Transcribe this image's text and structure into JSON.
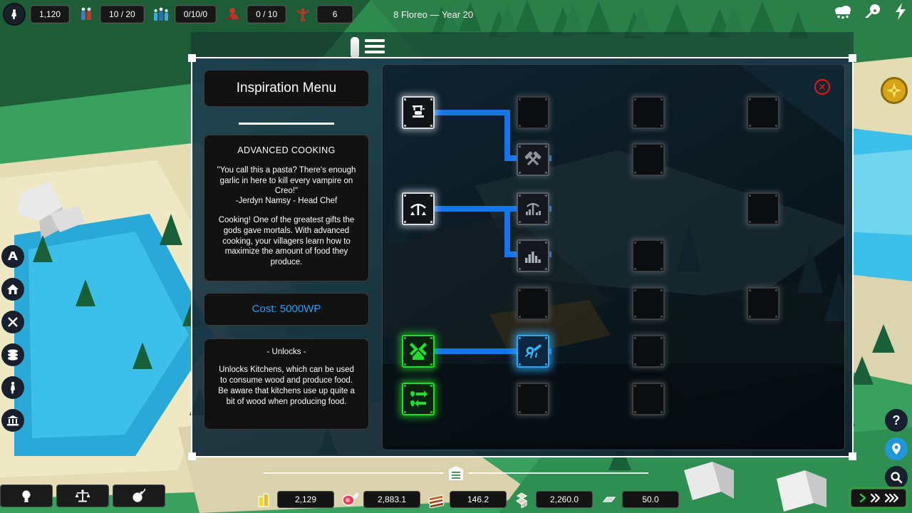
{
  "topbar": {
    "faith_icon": "prayer-icon",
    "faith_value": "1,120",
    "population_icon": "villagers-icon",
    "population_value": "10 / 20",
    "workers_icon": "workforce-icon",
    "workers_value": "0/10/0",
    "soldiers_icon": "soldier-icon",
    "soldiers_value": "0 / 10",
    "happiness_icon": "happiness-icon",
    "happiness_value": "6",
    "date_label": "8 Floreo — Year 20",
    "right_icons": [
      "weather-rain-icon",
      "comet-icon",
      "lightning-icon"
    ]
  },
  "menu_button": {
    "icon": "hamburger-menu-icon"
  },
  "left_sidebar": {
    "items": [
      {
        "icon": "military-icon",
        "label": "Military"
      },
      {
        "icon": "housing-icon",
        "label": "Housing"
      },
      {
        "icon": "tools-icon",
        "label": "Production"
      },
      {
        "icon": "resources-icon",
        "label": "Resources"
      },
      {
        "icon": "faith-icon",
        "label": "Faith"
      },
      {
        "icon": "government-icon",
        "label": "Government"
      }
    ]
  },
  "right_sidebar": {
    "compass_icon": "compass-icon",
    "items": [
      {
        "icon": "help-icon",
        "label": "Help"
      },
      {
        "icon": "location-pin-icon",
        "label": "Locate"
      },
      {
        "icon": "search-icon",
        "label": "Search"
      }
    ]
  },
  "window": {
    "title": "Inspiration Menu",
    "close_icon": "close-icon",
    "detail": {
      "name": "ADVANCED COOKING",
      "quote": "\"You call this a pasta? There's enough garlic in here to kill every vampire on Creo!\"",
      "author": "-Jerdyn Namsy - Head Chef",
      "body": "Cooking! One of the greatest gifts the gods gave mortals. With advanced cooking, your villagers learn how to maximize the amount of food they produce.",
      "cost": "Cost: 5000WP",
      "cost_color": "#2a9df4",
      "unlocks_title": "- Unlocks -",
      "unlocks_body": "Unlocks Kitchens, which can be used to consume wood and produce food. Be aware that kitchens use up quite a bit of wood when producing food."
    },
    "tech_tree": {
      "nodes": [
        {
          "id": "n-c1-r1",
          "col": 1,
          "row": 1,
          "state": "done",
          "icon": "anvil-icon"
        },
        {
          "id": "n-c2-r1",
          "col": 2,
          "row": 1,
          "state": "locked",
          "icon": "empty-icon"
        },
        {
          "id": "n-c3-r1",
          "col": 3,
          "row": 1,
          "state": "locked",
          "icon": "empty-icon"
        },
        {
          "id": "n-c4-r1",
          "col": 4,
          "row": 1,
          "state": "locked",
          "icon": "empty-icon"
        },
        {
          "id": "n-c2-r2",
          "col": 2,
          "row": 2,
          "state": "dim",
          "icon": "crossed-hammers-icon"
        },
        {
          "id": "n-c3-r2",
          "col": 3,
          "row": 2,
          "state": "locked",
          "icon": "empty-icon"
        },
        {
          "id": "n-c1-r3",
          "col": 1,
          "row": 3,
          "state": "done",
          "icon": "mine-icon"
        },
        {
          "id": "n-c2-r3",
          "col": 2,
          "row": 3,
          "state": "dim",
          "icon": "pickaxe-ore-icon"
        },
        {
          "id": "n-c4-r3",
          "col": 4,
          "row": 3,
          "state": "locked",
          "icon": "empty-icon"
        },
        {
          "id": "n-c2-r4",
          "col": 2,
          "row": 4,
          "state": "dim",
          "icon": "quarry-icon"
        },
        {
          "id": "n-c3-r4",
          "col": 3,
          "row": 4,
          "state": "locked",
          "icon": "empty-icon"
        },
        {
          "id": "n-c2-r5",
          "col": 2,
          "row": 5,
          "state": "locked",
          "icon": "empty-icon"
        },
        {
          "id": "n-c3-r5",
          "col": 3,
          "row": 5,
          "state": "locked",
          "icon": "empty-icon"
        },
        {
          "id": "n-c4-r5",
          "col": 4,
          "row": 5,
          "state": "locked",
          "icon": "empty-icon"
        },
        {
          "id": "n-c1-r6",
          "col": 1,
          "row": 6,
          "state": "green",
          "icon": "windmill-icon"
        },
        {
          "id": "n-c2-r6",
          "col": 2,
          "row": 6,
          "state": "sel",
          "icon": "cooking-pot-icon"
        },
        {
          "id": "n-c3-r6",
          "col": 3,
          "row": 6,
          "state": "locked",
          "icon": "empty-icon"
        },
        {
          "id": "n-c1-r7",
          "col": 1,
          "row": 7,
          "state": "green",
          "icon": "trade-icon"
        },
        {
          "id": "n-c2-r7",
          "col": 2,
          "row": 7,
          "state": "locked",
          "icon": "empty-icon"
        },
        {
          "id": "n-c3-r7",
          "col": 3,
          "row": 7,
          "state": "locked",
          "icon": "empty-icon"
        }
      ],
      "link_color": "#1675e8",
      "colors": {
        "researched": "#d8dde1",
        "available": "#22dd2a",
        "selected": "#2ea8f0",
        "locked": "#3b3f42"
      }
    }
  },
  "bottom_bar": {
    "buttons": [
      {
        "icon": "lightbulb-icon",
        "label": "Inspiration"
      },
      {
        "icon": "scales-icon",
        "label": "Laws"
      },
      {
        "icon": "bomb-icon",
        "label": "Disasters"
      }
    ],
    "storage_icon": "storage-icon",
    "resources": [
      {
        "icon": "gold-icon",
        "value": "2,129",
        "name": "gold"
      },
      {
        "icon": "food-icon",
        "value": "2,883.1",
        "name": "food"
      },
      {
        "icon": "wood-icon",
        "value": "146.2",
        "name": "wood"
      },
      {
        "icon": "stone-icon",
        "value": "2,260.0",
        "name": "stone"
      },
      {
        "icon": "metal-icon",
        "value": "50.0",
        "name": "metal"
      }
    ],
    "speed": {
      "icons": [
        "play-icon",
        "fast-forward-icon",
        "very-fast-forward-icon"
      ]
    }
  }
}
